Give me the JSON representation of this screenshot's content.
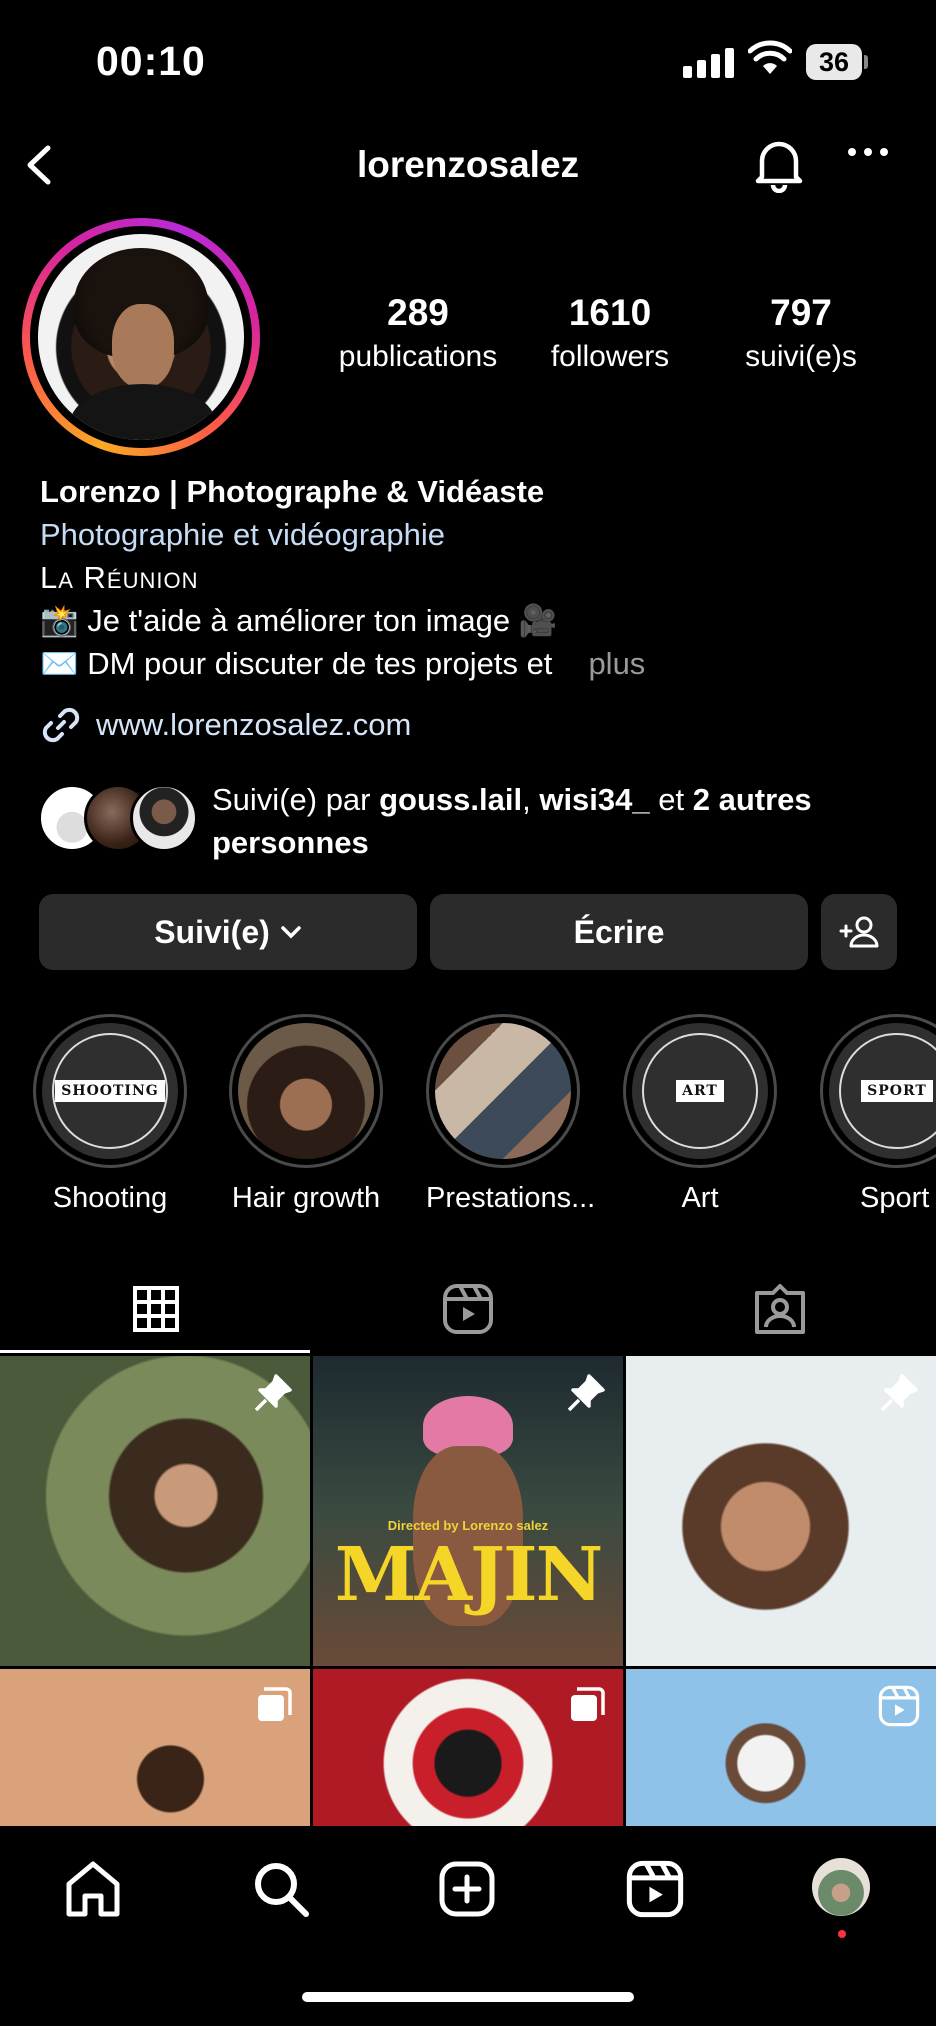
{
  "status_bar": {
    "time": "00:10",
    "battery": "36"
  },
  "header": {
    "username": "lorenzosalez"
  },
  "stats": [
    {
      "num": "289",
      "label": "publications"
    },
    {
      "num": "1610",
      "label": "followers"
    },
    {
      "num": "797",
      "label": "suivi(e)s"
    }
  ],
  "bio": {
    "name": "Lorenzo | Photographe & Vidéaste",
    "category": "Photographie et vidéographie",
    "location": "La Réunion",
    "line1": "📸 Je t'aide à améliorer ton image 🎥",
    "line2": "✉️ DM pour discuter de tes projets et",
    "more": "plus",
    "link": "www.lorenzosalez.com"
  },
  "followed_by": {
    "prefix": "Suivi(e) par ",
    "user1": "gouss.lail",
    "sep": ", ",
    "user2": "wisi34_",
    "mid": " et ",
    "rest": "2 autres personnes"
  },
  "buttons": {
    "following": "Suivi(e)",
    "message": "Écrire"
  },
  "highlights": [
    {
      "label": "Shooting",
      "badge": "SHOOTING"
    },
    {
      "label": "Hair growth"
    },
    {
      "label": "Prestations..."
    },
    {
      "label": "Art",
      "badge": "ART"
    },
    {
      "label": "Sport",
      "badge": "SPORT"
    }
  ],
  "grid": {
    "post2_title": "MAJIN",
    "post2_caption": "Directed by Lorenzo salez"
  },
  "icons": [
    "back-icon",
    "bell-icon",
    "more-icon",
    "link-icon",
    "chevron-down-icon",
    "add-person-icon",
    "grid-icon",
    "reels-icon",
    "tagged-icon",
    "pin-icon",
    "carousel-icon",
    "reel-icon",
    "home-icon",
    "search-icon",
    "create-icon",
    "profile-avatar-icon"
  ],
  "colors": {
    "bio_category": "#c6dcf5",
    "button_bg": "#2b2b2b",
    "notification_dot": "#ff3040"
  }
}
